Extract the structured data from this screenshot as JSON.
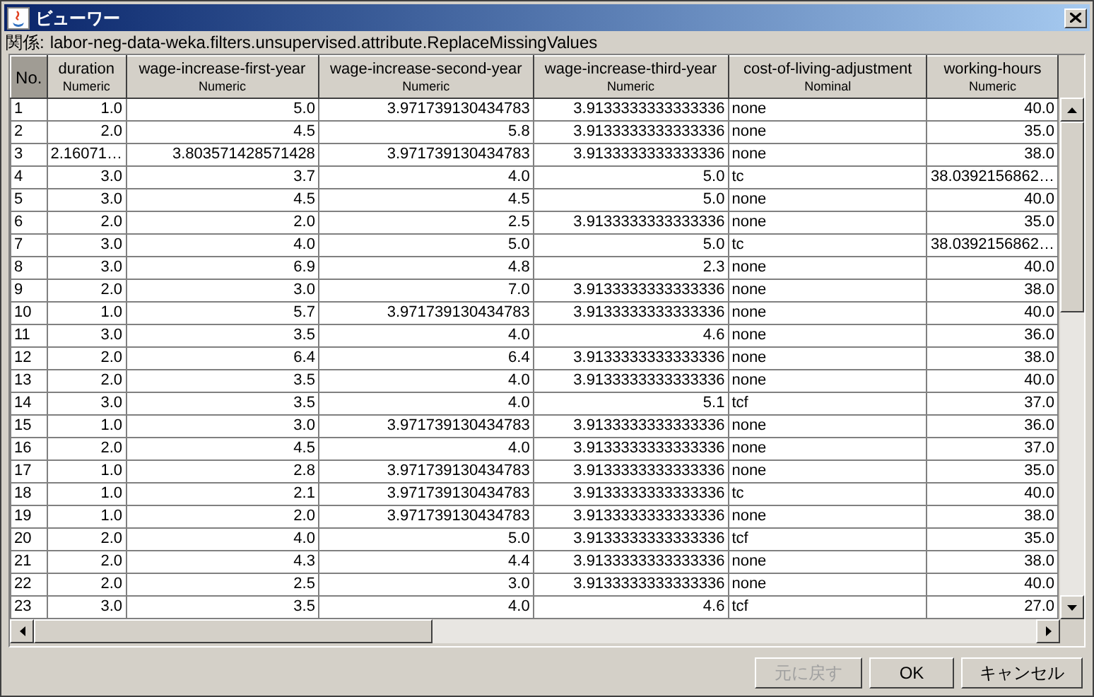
{
  "window": {
    "title": "ビューワー"
  },
  "relation": {
    "label": "関係:",
    "value": "labor-neg-data-weka.filters.unsupervised.attribute.ReplaceMissingValues"
  },
  "table": {
    "columns": [
      {
        "name": "No.",
        "kind": "index"
      },
      {
        "name": "duration",
        "type": "Numeric",
        "kind": "numeric"
      },
      {
        "name": "wage-increase-first-year",
        "type": "Numeric",
        "kind": "numeric"
      },
      {
        "name": "wage-increase-second-year",
        "type": "Numeric",
        "kind": "numeric"
      },
      {
        "name": "wage-increase-third-year",
        "type": "Numeric",
        "kind": "numeric"
      },
      {
        "name": "cost-of-living-adjustment",
        "type": "Nominal",
        "kind": "nominal"
      },
      {
        "name": "working-hours",
        "type": "Numeric",
        "kind": "numeric"
      }
    ],
    "rows": [
      [
        "1",
        "1.0",
        "5.0",
        "3.971739130434783",
        "3.9133333333333336",
        "none",
        "40.0"
      ],
      [
        "2",
        "2.0",
        "4.5",
        "5.8",
        "3.9133333333333336",
        "none",
        "35.0"
      ],
      [
        "3",
        "2.16071…",
        "3.803571428571428",
        "3.971739130434783",
        "3.9133333333333336",
        "none",
        "38.0"
      ],
      [
        "4",
        "3.0",
        "3.7",
        "4.0",
        "5.0",
        "tc",
        "38.0392156862…"
      ],
      [
        "5",
        "3.0",
        "4.5",
        "4.5",
        "5.0",
        "none",
        "40.0"
      ],
      [
        "6",
        "2.0",
        "2.0",
        "2.5",
        "3.9133333333333336",
        "none",
        "35.0"
      ],
      [
        "7",
        "3.0",
        "4.0",
        "5.0",
        "5.0",
        "tc",
        "38.0392156862…"
      ],
      [
        "8",
        "3.0",
        "6.9",
        "4.8",
        "2.3",
        "none",
        "40.0"
      ],
      [
        "9",
        "2.0",
        "3.0",
        "7.0",
        "3.9133333333333336",
        "none",
        "38.0"
      ],
      [
        "10",
        "1.0",
        "5.7",
        "3.971739130434783",
        "3.9133333333333336",
        "none",
        "40.0"
      ],
      [
        "11",
        "3.0",
        "3.5",
        "4.0",
        "4.6",
        "none",
        "36.0"
      ],
      [
        "12",
        "2.0",
        "6.4",
        "6.4",
        "3.9133333333333336",
        "none",
        "38.0"
      ],
      [
        "13",
        "2.0",
        "3.5",
        "4.0",
        "3.9133333333333336",
        "none",
        "40.0"
      ],
      [
        "14",
        "3.0",
        "3.5",
        "4.0",
        "5.1",
        "tcf",
        "37.0"
      ],
      [
        "15",
        "1.0",
        "3.0",
        "3.971739130434783",
        "3.9133333333333336",
        "none",
        "36.0"
      ],
      [
        "16",
        "2.0",
        "4.5",
        "4.0",
        "3.9133333333333336",
        "none",
        "37.0"
      ],
      [
        "17",
        "1.0",
        "2.8",
        "3.971739130434783",
        "3.9133333333333336",
        "none",
        "35.0"
      ],
      [
        "18",
        "1.0",
        "2.1",
        "3.971739130434783",
        "3.9133333333333336",
        "tc",
        "40.0"
      ],
      [
        "19",
        "1.0",
        "2.0",
        "3.971739130434783",
        "3.9133333333333336",
        "none",
        "38.0"
      ],
      [
        "20",
        "2.0",
        "4.0",
        "5.0",
        "3.9133333333333336",
        "tcf",
        "35.0"
      ],
      [
        "21",
        "2.0",
        "4.3",
        "4.4",
        "3.9133333333333336",
        "none",
        "38.0"
      ],
      [
        "22",
        "2.0",
        "2.5",
        "3.0",
        "3.9133333333333336",
        "none",
        "40.0"
      ],
      [
        "23",
        "3.0",
        "3.5",
        "4.0",
        "4.6",
        "tcf",
        "27.0"
      ]
    ]
  },
  "buttons": [
    {
      "label": "元に戻す",
      "disabled": true
    },
    {
      "label": "OK",
      "disabled": false
    },
    {
      "label": "キャンセル",
      "disabled": false
    }
  ]
}
